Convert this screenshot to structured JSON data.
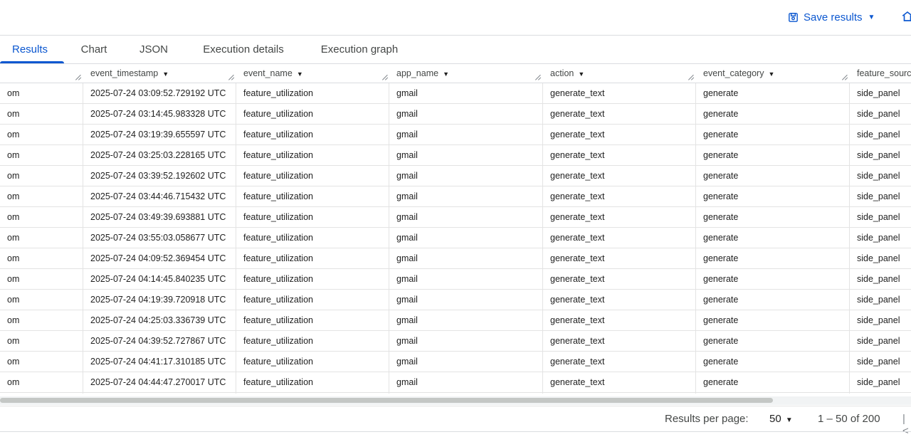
{
  "toolbar": {
    "save_label": "Save results"
  },
  "tabs": [
    {
      "label": "Results",
      "active": true
    },
    {
      "label": "Chart",
      "active": false
    },
    {
      "label": "JSON",
      "active": false
    },
    {
      "label": "Execution details",
      "active": false
    },
    {
      "label": "Execution graph",
      "active": false
    }
  ],
  "table": {
    "columns": [
      "",
      "event_timestamp",
      "event_name",
      "app_name",
      "action",
      "event_category",
      "feature_sourc"
    ],
    "rows": [
      [
        "om",
        "2025-07-24 03:09:52.729192 UTC",
        "feature_utilization",
        "gmail",
        "generate_text",
        "generate",
        "side_panel"
      ],
      [
        "om",
        "2025-07-24 03:14:45.983328 UTC",
        "feature_utilization",
        "gmail",
        "generate_text",
        "generate",
        "side_panel"
      ],
      [
        "om",
        "2025-07-24 03:19:39.655597 UTC",
        "feature_utilization",
        "gmail",
        "generate_text",
        "generate",
        "side_panel"
      ],
      [
        "om",
        "2025-07-24 03:25:03.228165 UTC",
        "feature_utilization",
        "gmail",
        "generate_text",
        "generate",
        "side_panel"
      ],
      [
        "om",
        "2025-07-24 03:39:52.192602 UTC",
        "feature_utilization",
        "gmail",
        "generate_text",
        "generate",
        "side_panel"
      ],
      [
        "om",
        "2025-07-24 03:44:46.715432 UTC",
        "feature_utilization",
        "gmail",
        "generate_text",
        "generate",
        "side_panel"
      ],
      [
        "om",
        "2025-07-24 03:49:39.693881 UTC",
        "feature_utilization",
        "gmail",
        "generate_text",
        "generate",
        "side_panel"
      ],
      [
        "om",
        "2025-07-24 03:55:03.058677 UTC",
        "feature_utilization",
        "gmail",
        "generate_text",
        "generate",
        "side_panel"
      ],
      [
        "om",
        "2025-07-24 04:09:52.369454 UTC",
        "feature_utilization",
        "gmail",
        "generate_text",
        "generate",
        "side_panel"
      ],
      [
        "om",
        "2025-07-24 04:14:45.840235 UTC",
        "feature_utilization",
        "gmail",
        "generate_text",
        "generate",
        "side_panel"
      ],
      [
        "om",
        "2025-07-24 04:19:39.720918 UTC",
        "feature_utilization",
        "gmail",
        "generate_text",
        "generate",
        "side_panel"
      ],
      [
        "om",
        "2025-07-24 04:25:03.336739 UTC",
        "feature_utilization",
        "gmail",
        "generate_text",
        "generate",
        "side_panel"
      ],
      [
        "om",
        "2025-07-24 04:39:52.727867 UTC",
        "feature_utilization",
        "gmail",
        "generate_text",
        "generate",
        "side_panel"
      ],
      [
        "om",
        "2025-07-24 04:41:17.310185 UTC",
        "feature_utilization",
        "gmail",
        "generate_text",
        "generate",
        "side_panel"
      ],
      [
        "om",
        "2025-07-24 04:44:47.270017 UTC",
        "feature_utilization",
        "gmail",
        "generate_text",
        "generate",
        "side_panel"
      ]
    ]
  },
  "footer": {
    "rows_per_page_label": "Results per page:",
    "rows_per_page_value": "50",
    "range_label": "1 – 50 of 200",
    "first_page_glyph": "|<"
  },
  "colors": {
    "accent": "#0b57d0",
    "border": "#dadce0",
    "text": "#1f1f1f",
    "muted": "#444746"
  },
  "icons": [
    "save-icon",
    "home-icon",
    "sort-caret-icon",
    "resize-handle-icon",
    "first-page-icon"
  ]
}
